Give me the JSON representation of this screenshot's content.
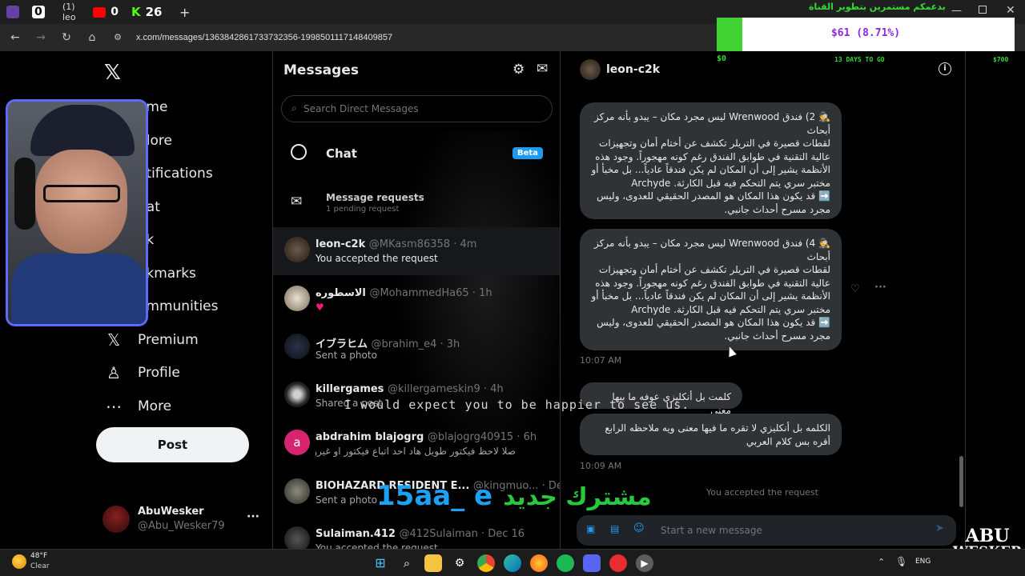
{
  "browser": {
    "tabs": [
      {
        "label": "0"
      },
      {
        "label": "(1) leo"
      },
      {
        "label": "0"
      },
      {
        "label": "26"
      }
    ],
    "new_tab": "+",
    "url": "x.com/messages/1363842861733732356-1998501117148409857"
  },
  "nav": {
    "items": [
      {
        "label": "ome"
      },
      {
        "label": "plore"
      },
      {
        "label": "otifications"
      },
      {
        "label": "hat"
      },
      {
        "label": "ok"
      },
      {
        "label": "okmarks"
      },
      {
        "label": "ommunities"
      },
      {
        "label": "Premium"
      },
      {
        "label": "Profile"
      },
      {
        "label": "More"
      }
    ],
    "post_label": "Post",
    "account_name": "AbuWesker",
    "account_handle": "@Abu_Wesker79"
  },
  "messages": {
    "title": "Messages",
    "search_placeholder": "Search Direct Messages",
    "chat_label": "Chat",
    "beta_badge": "Beta",
    "requests_title": "Message requests",
    "requests_sub": "1 pending request",
    "conversations": [
      {
        "name": "leon-c2k",
        "handle": "@MKasm86358 · 4m",
        "preview": "You accepted the request"
      },
      {
        "name": "الاسطوره",
        "handle": "@MohammedHa65 · 1h",
        "preview": "♥"
      },
      {
        "name": "イブラヒム",
        "handle": "@brahim_e4 · 3h",
        "preview": "Sent a photo"
      },
      {
        "name": "killergames",
        "handle": "@killergameskin9 · 4h",
        "preview": "Shared a post"
      },
      {
        "name": "abdrahim blajogrg",
        "handle": "@blajogrg40915 · 6h",
        "preview": "صلا لاحظ فيكتور طويل هاد احد اتباع فيكتور او غيرو..."
      },
      {
        "name": "BIOHAZARD RESIDENT E...",
        "handle": "@kingmuo... · Dec 16",
        "preview": "Sent a photo"
      },
      {
        "name": "Sulaiman.412",
        "handle": "@412Sulaiman · Dec 16",
        "preview": "You accepted the request"
      }
    ]
  },
  "conversation": {
    "name": "leon-c2k",
    "bubbles": [
      {
        "text": "🕵️ 2) فندق Wrenwood ليس مجرد مكان – يبدو بأنه مركز أبحاث\nلقطات قصيرة في التريلر تكشف عن أختام أمان وتجهيزات عالية التقنية في طوابق الفندق رغم كونه مهجوراً. وجود هذه الأنظمة يشير إلى أن المكان لم يكن فندقاً عادياً... بل مخبأ أو مختبر سري يتم التحكم فيه قبل الكارثة. Archyde\n➡️ قد يكون هذا المكان هو المصدر الحقيقي للعدوى، وليس مجرد مسرح أحداث جانبي."
      },
      {
        "text": "🕵️ 4) فندق Wrenwood ليس مجرد مكان – يبدو بأنه مركز أبحاث\nلقطات قصيرة في التريلر تكشف عن أختام أمان وتجهيزات عالية التقنية في طوابق الفندق رغم كونه مهجوراً. وجود هذه الأنظمة يشير إلى أن المكان لم يكن فندقاً عادياً... بل مخبأ أو مختبر سري يتم التحكم فيه قبل الكارثة. Archyde\n➡️ قد يكون هذا المكان هو المصدر الحقيقي للعدوى، وليس مجرد مسرح أحداث جانبي."
      },
      {
        "text": "كلمت بل أنكليزي عوفه ما بيها معنى"
      },
      {
        "text": "الكلمه بل أنكليزي لا تقره ما فيها معنى ويه ملاحظه الرابع أقره بس كلام العربي"
      }
    ],
    "time1": "10:07 AM",
    "time2": "10:09 AM",
    "accepted_notice": "You accepted the request",
    "composer_placeholder": "Start a new message"
  },
  "overlays": {
    "donation_header": "بدعمكم مستمرين بتطوير القناة",
    "donation_amount": "$61 (8.71%)",
    "donation_progress": 0.0871,
    "donation_min": "$0",
    "donation_days": "13 DAYS TO GO",
    "donation_max": "$700",
    "subtitle": "I would expect you to be happier to see us.",
    "new_sub_text": "مشترك جديد",
    "new_sub_name": "15aa_ e",
    "watermark_line1": "ABU",
    "watermark_line2": "WESKER"
  },
  "taskbar": {
    "temperature": "48°F",
    "weather": "Clear",
    "language": "ENG"
  },
  "colors": {
    "accent": "#1d9bf0",
    "donation_green": "#2fd12f",
    "new_sub_green": "#27c93f",
    "new_sub_blue": "#1da1f2"
  }
}
